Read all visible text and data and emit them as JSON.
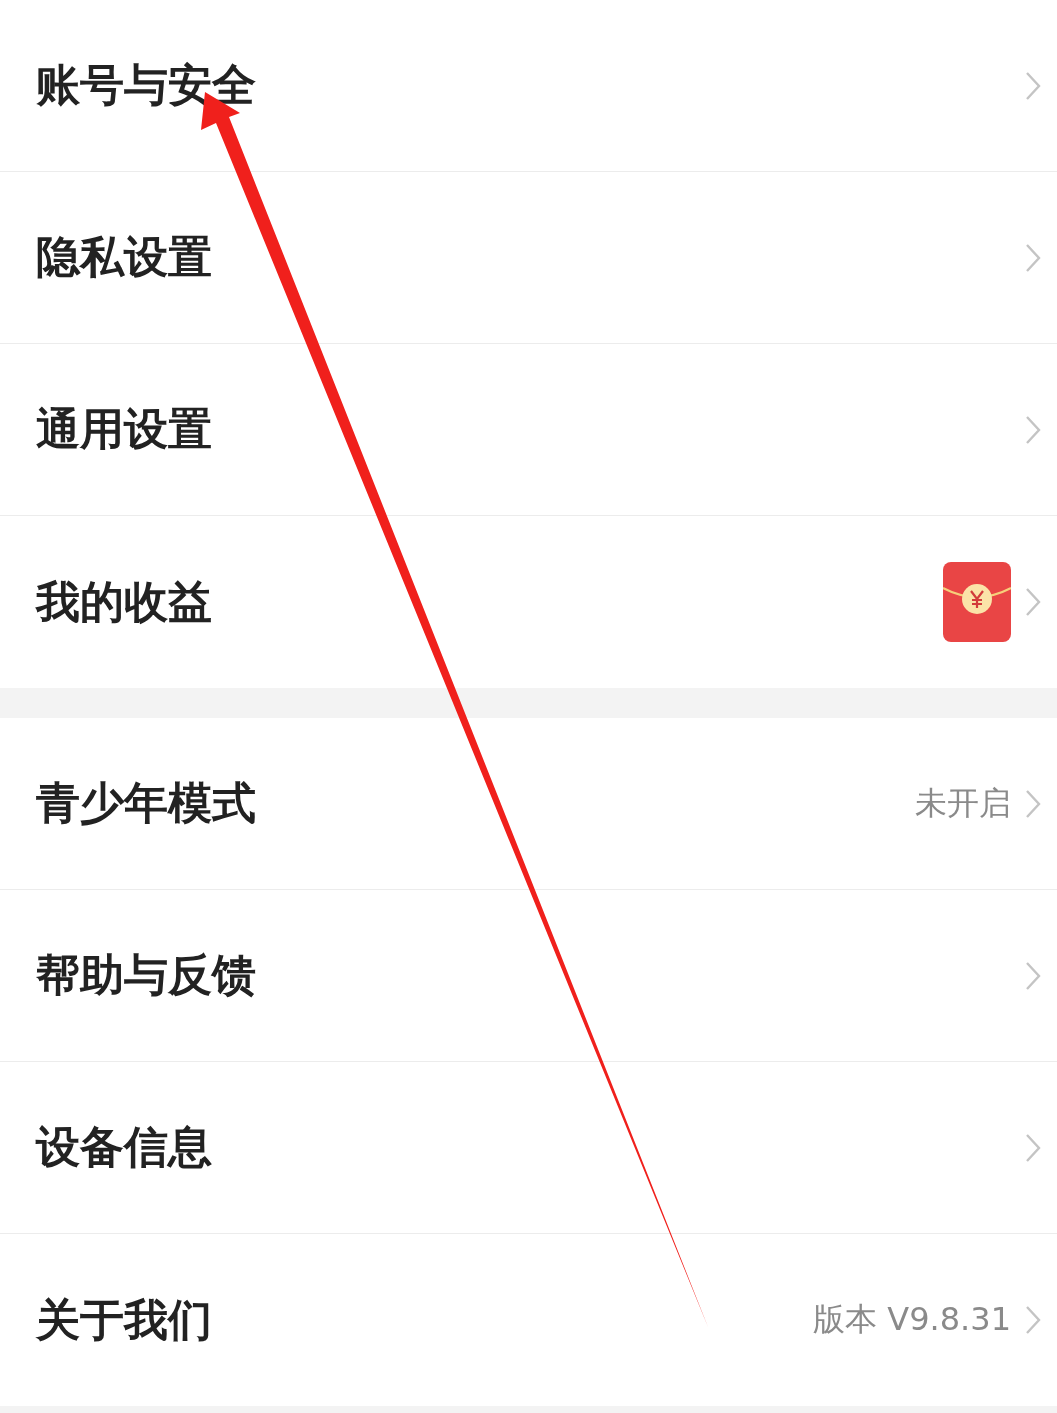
{
  "sections": [
    {
      "items": [
        {
          "kind": "plain",
          "label": "账号与安全"
        },
        {
          "kind": "plain",
          "label": "隐私设置"
        },
        {
          "kind": "plain",
          "label": "通用设置"
        },
        {
          "kind": "red-packet",
          "label": "我的收益"
        }
      ]
    },
    {
      "items": [
        {
          "kind": "value",
          "label": "青少年模式",
          "value": "未开启"
        },
        {
          "kind": "plain",
          "label": "帮助与反馈"
        },
        {
          "kind": "plain",
          "label": "设备信息"
        },
        {
          "kind": "value",
          "label": "关于我们",
          "value": "版本 V9.8.31"
        }
      ]
    }
  ]
}
